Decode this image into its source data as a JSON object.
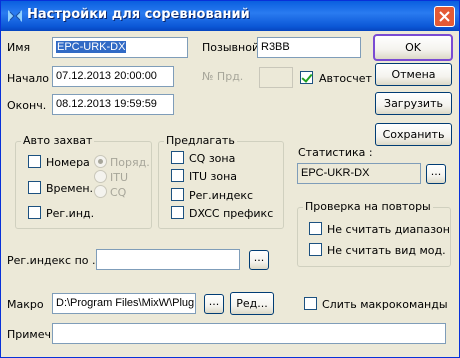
{
  "window": {
    "title": "Настройки для соревнований"
  },
  "fields": {
    "name_label": "Имя",
    "name_value": "EPC-URK-DX",
    "callsign_label": "Позывной",
    "callsign_value": "R3BB",
    "start_label": "Начало",
    "start_value": "07.12.2013 20:00:00",
    "end_label": "Оконч.",
    "end_value": "08.12.2013 19:59:59",
    "prd_label": "№ Прд.",
    "prd_value": "",
    "autocount_label": "Автосчет"
  },
  "buttons": {
    "ok": "OK",
    "cancel": "Отмена",
    "load": "Загрузить",
    "save": "Сохранить",
    "browse": "...",
    "edit": "Ред..."
  },
  "autocapture": {
    "title": "Авто захват",
    "items": [
      "Номера",
      "Времен.",
      "Рег.инд."
    ],
    "radios": [
      "Поряд.",
      "ITU",
      "CQ"
    ]
  },
  "suggest": {
    "title": "Предлагать",
    "items": [
      "CQ зона",
      "ITU зона",
      "Рег.индекс",
      "DXCC префикс"
    ]
  },
  "statistics": {
    "label": "Статистика :",
    "value": "EPC-UKR-DX"
  },
  "repeats": {
    "title": "Проверка на повторы",
    "items": [
      "Не считать диапазон",
      "Не считать вид мод."
    ]
  },
  "regindex": {
    "label": "Рег.индекс по ...",
    "value": ""
  },
  "macro": {
    "label": "Макро",
    "value": "D:\\Program Files\\MixW\\Plug",
    "merge_label": "Слить макрокоманды"
  },
  "note": {
    "label": "Примеч.",
    "value": ""
  }
}
